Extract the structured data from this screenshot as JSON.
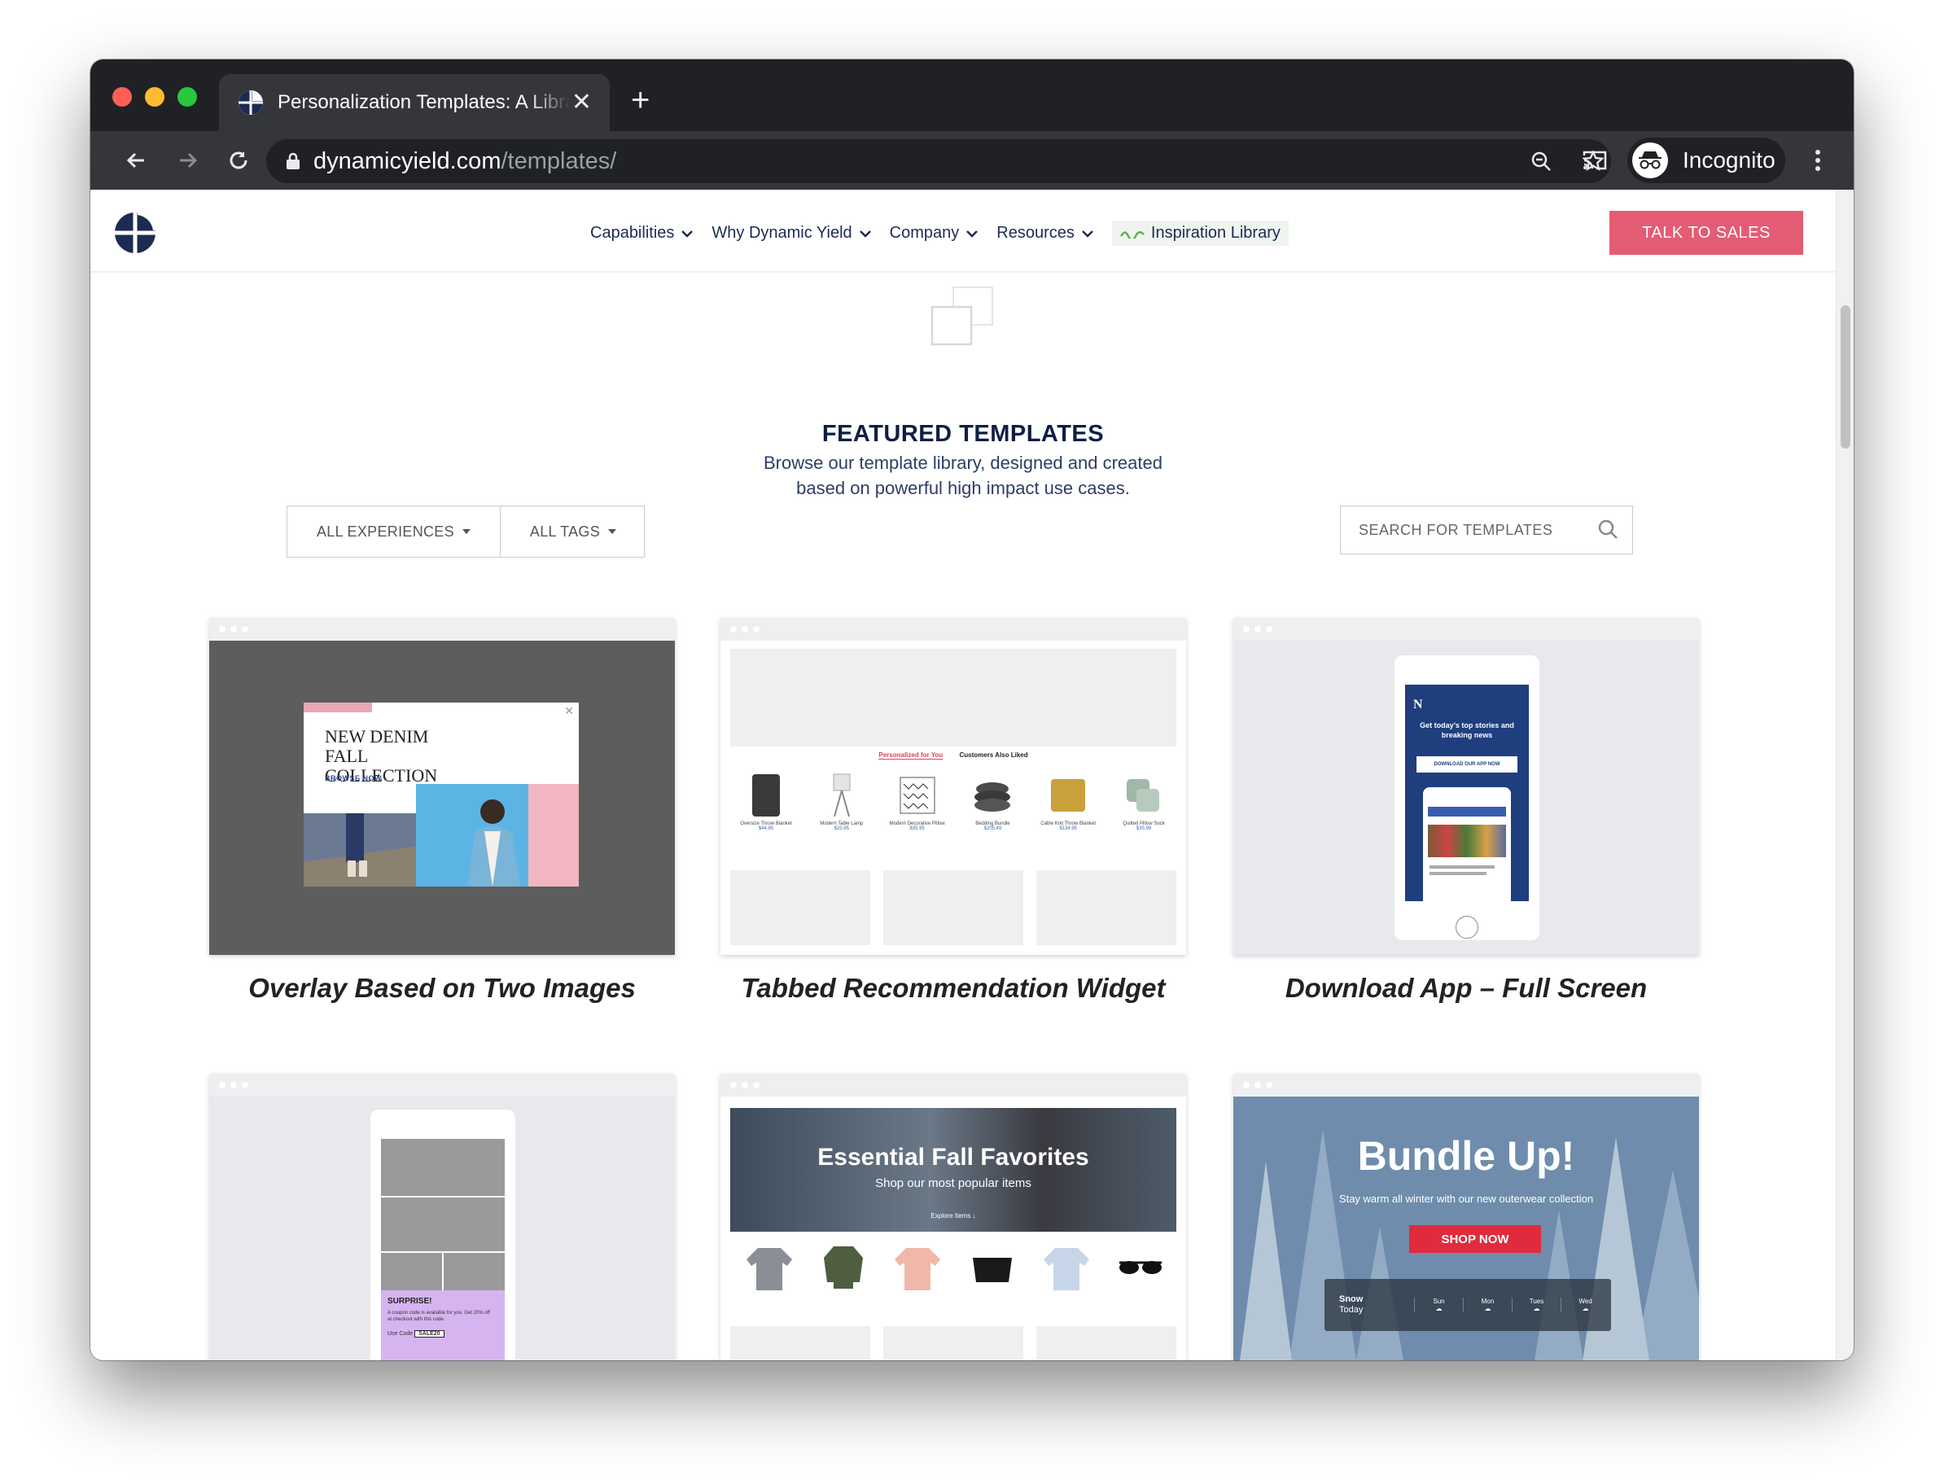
{
  "browser": {
    "tab_title": "Personalization Templates: A Library of Use Cases",
    "url_domain": "dynamicyield.com",
    "url_path": "/templates/",
    "profile_label": "Incognito",
    "traffic_lights": [
      "#ff5f57",
      "#febc2e",
      "#28c840"
    ]
  },
  "nav": {
    "items": [
      {
        "label": "Capabilities"
      },
      {
        "label": "Why Dynamic Yield"
      },
      {
        "label": "Company"
      },
      {
        "label": "Resources"
      }
    ],
    "inspiration_label": "Inspiration Library",
    "cta_label": "TALK TO SALES",
    "cta_color": "#e35c73"
  },
  "hero": {
    "title": "FEATURED TEMPLATES",
    "subtitle_line1": "Browse our template library, designed and created",
    "subtitle_line2": "based on powerful high impact use cases."
  },
  "filters": {
    "experiences": "ALL EXPERIENCES",
    "tags": "ALL TAGS",
    "search_placeholder": "SEARCH FOR TEMPLATES"
  },
  "cards": [
    {
      "title": "Overlay Based on Two Images",
      "preview": {
        "headline": "NEW DENIM FALL COLLECTION",
        "link": "BROWSE NOW ›"
      }
    },
    {
      "title": "Tabbed Recommendation Widget",
      "preview": {
        "tab_active": "Personalized for You",
        "tab_other": "Customers Also Liked",
        "products": [
          {
            "name": "Oversize Throw Blanket",
            "price": "$44.85"
          },
          {
            "name": "Modern Table Lamp",
            "price": "$25.95"
          },
          {
            "name": "Modern Decorative Pillow",
            "price": "$35.95"
          },
          {
            "name": "Bedding Bundle",
            "price": "$205.49"
          },
          {
            "name": "Cable Knit Throw Blanket",
            "price": "$134.95"
          },
          {
            "name": "Quilted Pillow Sock",
            "price": "$35.99"
          }
        ]
      }
    },
    {
      "title": "Download App – Full Screen",
      "preview": {
        "logo": "N",
        "headline": "Get today’s top stories and breaking news",
        "button": "DOWNLOAD OUR APP NOW"
      }
    },
    {
      "title": "",
      "preview": {
        "headline": "SURPRISE!",
        "body": "A coupon code is available for you. Get 20% off at checkout with this code.",
        "code_label": "Use Code",
        "code": "SALE20"
      }
    },
    {
      "title": "",
      "preview": {
        "headline": "Essential Fall Favorites",
        "sub": "Shop our most popular items",
        "link": "Explore Items ↓"
      }
    },
    {
      "title": "",
      "preview": {
        "headline": "Bundle Up!",
        "sub": "Stay warm all winter with our new outerwear collection",
        "button": "SHOP NOW",
        "weather_now": "Snow",
        "weather_day": "Today",
        "days": [
          "Sun",
          "Mon",
          "Tues",
          "Wed"
        ]
      }
    }
  ]
}
